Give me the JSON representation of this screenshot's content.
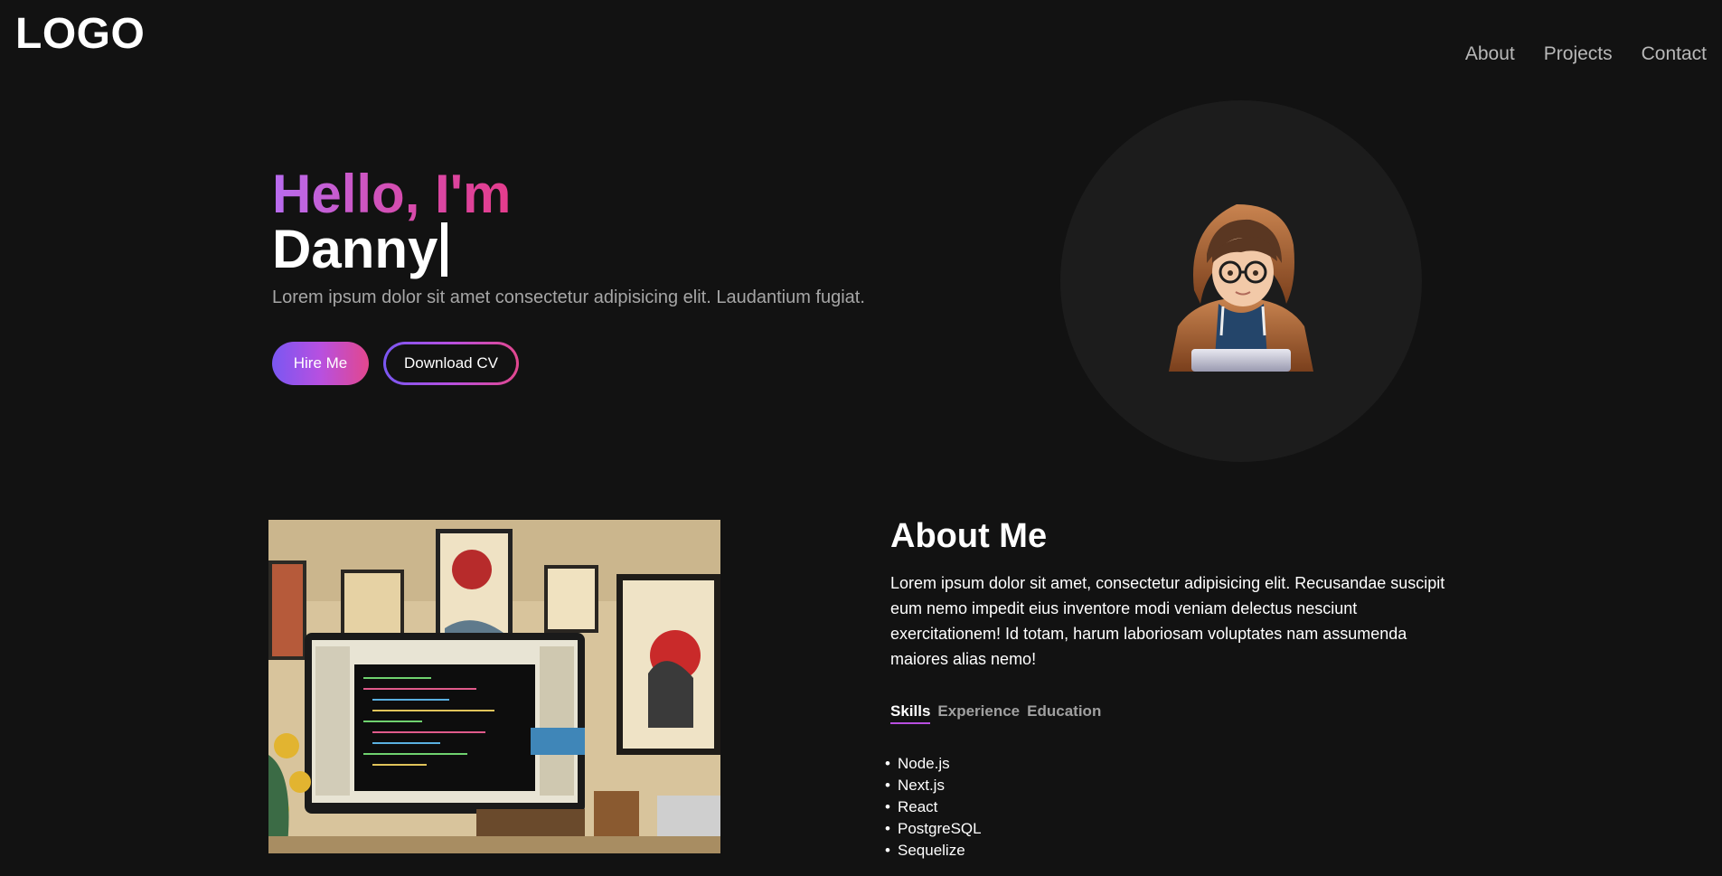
{
  "header": {
    "logo": "LOGO",
    "nav": [
      {
        "label": "About"
      },
      {
        "label": "Projects"
      },
      {
        "label": "Contact"
      }
    ]
  },
  "hero": {
    "greeting": "Hello, I'm",
    "name": "Danny",
    "description": "Lorem ipsum dolor sit amet consectetur adipisicing elit. Laudantium fugiat.",
    "hire_button": "Hire Me",
    "cv_button": "Download CV"
  },
  "about": {
    "title": "About Me",
    "text": "Lorem ipsum dolor sit amet, consectetur adipisicing elit. Recusandae suscipit eum nemo impedit eius inventore modi veniam delectus nesciunt exercitationem! Id totam, harum laboriosam voluptates nam assumenda maiores alias nemo!",
    "tabs": [
      {
        "label": "Skills"
      },
      {
        "label": "Experience"
      },
      {
        "label": "Education"
      }
    ],
    "skills": [
      "Node.js",
      "Next.js",
      "React",
      "PostgreSQL",
      "Sequelize"
    ]
  },
  "colors": {
    "background": "#121212",
    "accent_start": "#7a57f2",
    "accent_mid": "#b750e0",
    "accent_end": "#e2478e"
  }
}
